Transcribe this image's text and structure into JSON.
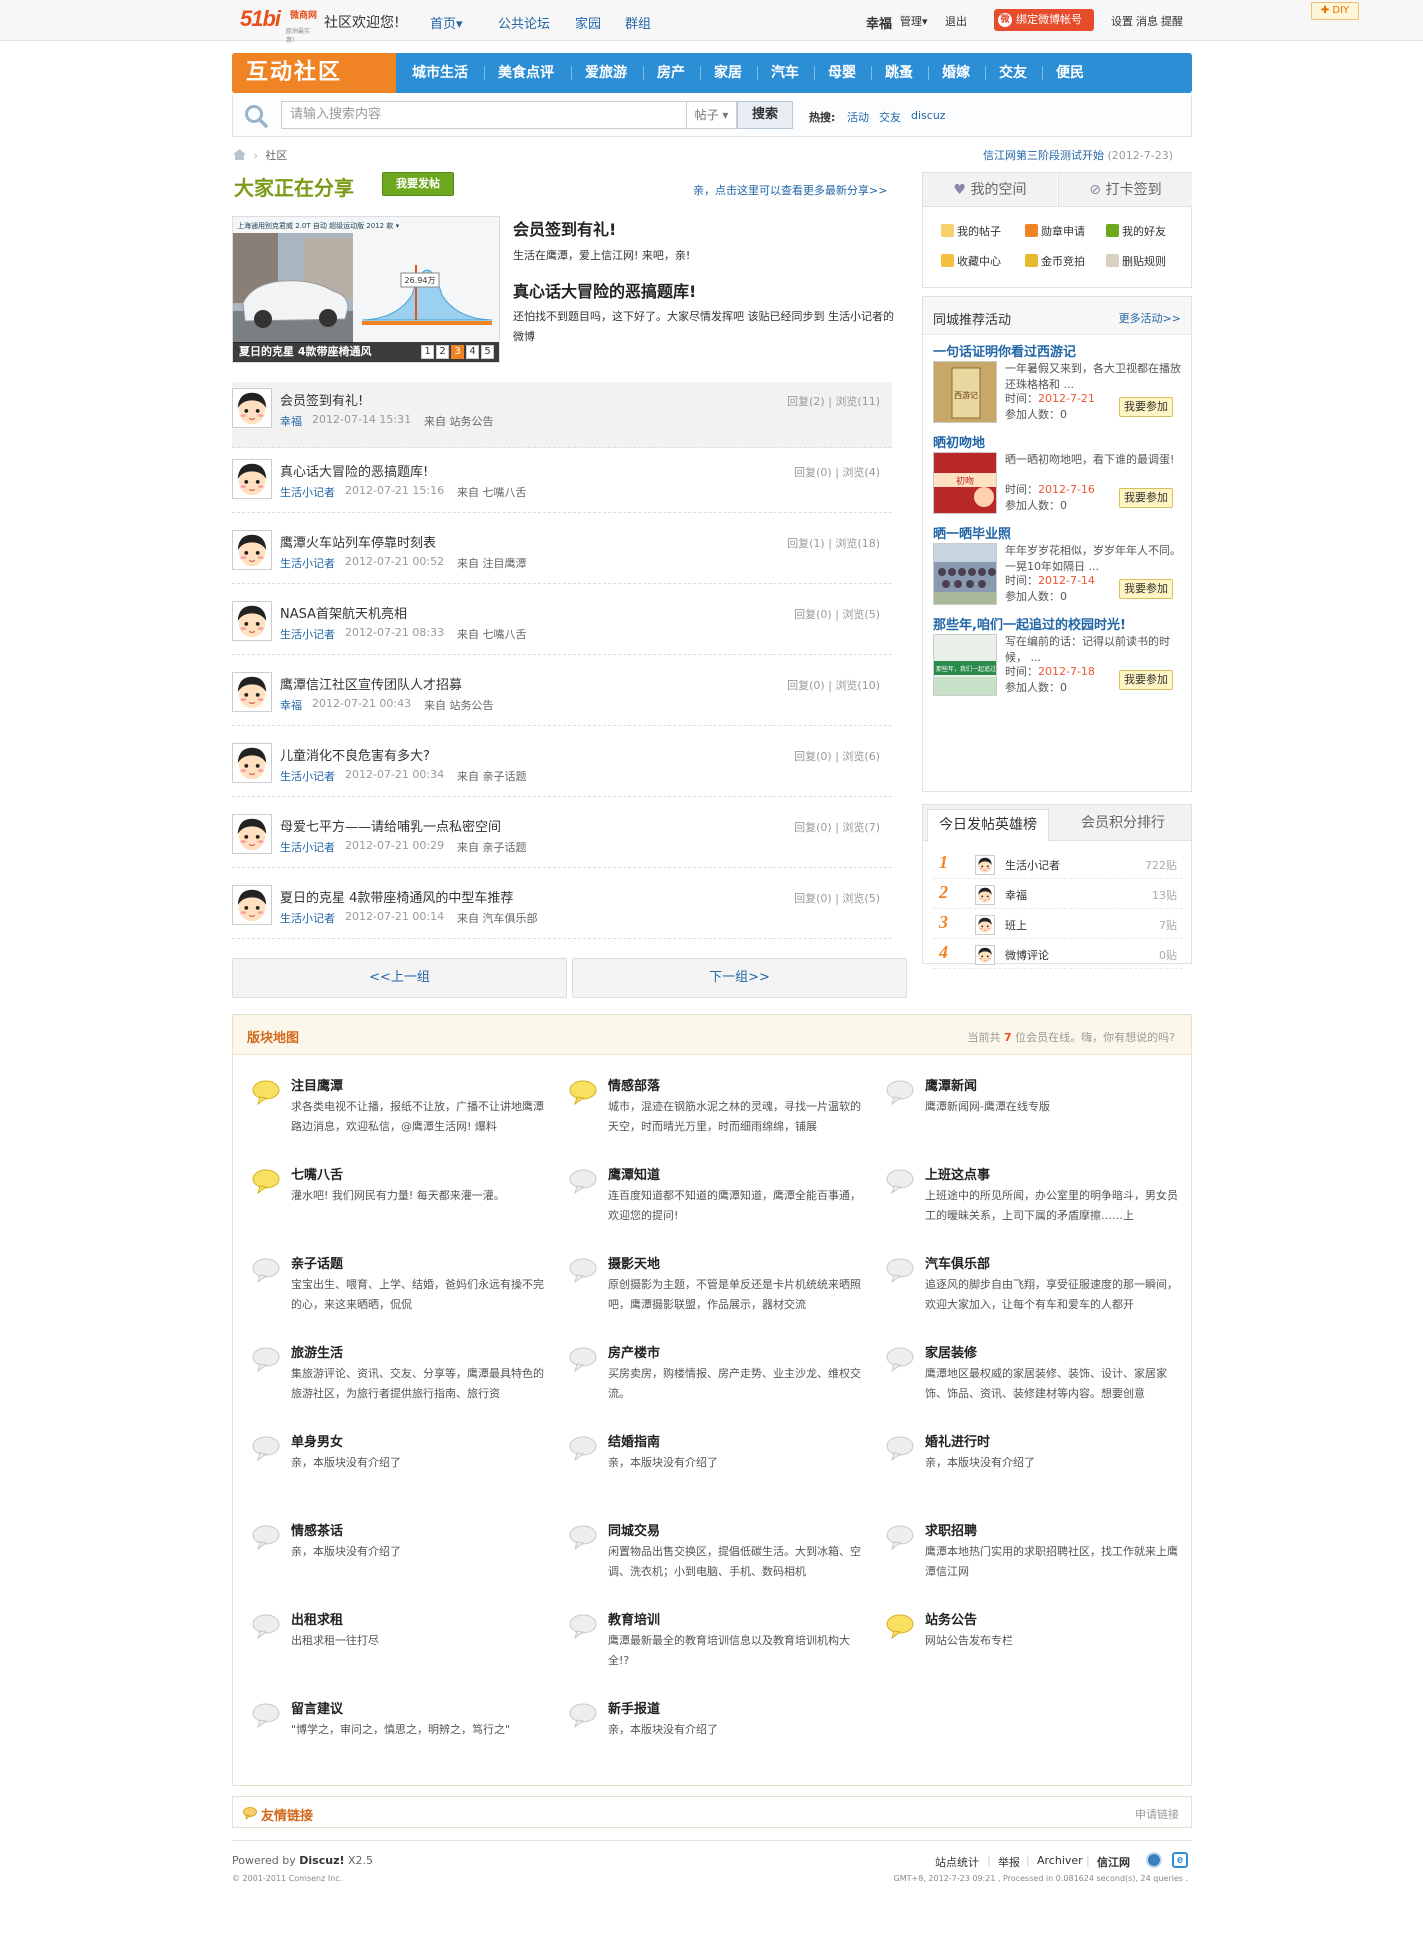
{
  "topbar": {
    "logo": {
      "main": "51bi",
      "sub": "微商网",
      "tagline": "欧洲最实惠!"
    },
    "welcome": "社区欢迎您!",
    "nav": [
      "首页▾",
      "公共论坛",
      "家园",
      "群组"
    ],
    "user": "幸福",
    "manage": "管理▾",
    "logout": "退出",
    "bind_weibo": "绑定微博帐号",
    "right_links": [
      "设置",
      "消息",
      "提醒"
    ],
    "diy": "DIY"
  },
  "nav": {
    "title": "互动社区",
    "items": [
      "城市生活",
      "美食点评",
      "爱旅游",
      "房产",
      "家居",
      "汽车",
      "母婴",
      "跳蚤",
      "婚嫁",
      "交友",
      "便民"
    ]
  },
  "search": {
    "placeholder": "请输入搜索内容",
    "type": "帖子 ▾",
    "button": "搜索",
    "hot_label": "热搜:",
    "hot": [
      "活动",
      "交友",
      "discuz"
    ]
  },
  "breadcrumb": {
    "home_icon": "home-icon",
    "current": "社区"
  },
  "notice": {
    "text": "信江网第三阶段测试开始",
    "date": "(2012-7-23)"
  },
  "share": {
    "title": "大家正在分享",
    "post_button": "我要发帖",
    "more": "亲，点击这里可以查看更多最新分享>>"
  },
  "slide": {
    "caption": "夏日的克星 4款带座椅通风",
    "pages": [
      "1",
      "2",
      "3",
      "4",
      "5"
    ],
    "active_page": 3,
    "header_text": "上海通用别克君威  2.0T 自动 超级运动版 2012 款 ▾",
    "price": "26.94万"
  },
  "headlines": [
    {
      "title": "会员签到有礼!",
      "desc": "生活在鹰潭，爱上信江网!  来吧，亲!"
    },
    {
      "title": "真心话大冒险的恶搞题库!",
      "desc": "还怕找不到题目吗，这下好了。大家尽情发挥吧 该贴已经同步到 生活小记者的微博"
    }
  ],
  "posts": [
    {
      "title": "会员签到有礼!",
      "user": "幸福",
      "date": "2012-07-14 15:31",
      "from": "来自 站务公告",
      "stats": "回复(2) | 浏览(11)"
    },
    {
      "title": "真心话大冒险的恶搞题库!",
      "user": "生活小记者",
      "date": "2012-07-21 15:16",
      "from": "来自 七嘴八舌",
      "stats": "回复(0) | 浏览(4)"
    },
    {
      "title": "鹰潭火车站列车停靠时刻表",
      "user": "生活小记者",
      "date": "2012-07-21 00:52",
      "from": "来自 注目鹰潭",
      "stats": "回复(1) | 浏览(18)"
    },
    {
      "title": "NASA首架航天机亮相",
      "user": "生活小记者",
      "date": "2012-07-21 08:33",
      "from": "来自 七嘴八舌",
      "stats": "回复(0) | 浏览(5)"
    },
    {
      "title": "鹰潭信江社区宣传团队人才招募",
      "user": "幸福",
      "date": "2012-07-21 00:43",
      "from": "来自 站务公告",
      "stats": "回复(0) | 浏览(10)"
    },
    {
      "title": "儿童消化不良危害有多大?",
      "user": "生活小记者",
      "date": "2012-07-21 00:34",
      "from": "来自 亲子话题",
      "stats": "回复(0) | 浏览(6)"
    },
    {
      "title": "母爱七平方——请给哺乳一点私密空间",
      "user": "生活小记者",
      "date": "2012-07-21 00:29",
      "from": "来自 亲子话题",
      "stats": "回复(0) | 浏览(7)"
    },
    {
      "title": "夏日的克星 4款带座椅通风的中型车推荐",
      "user": "生活小记者",
      "date": "2012-07-21 00:14",
      "from": "来自 汽车俱乐部",
      "stats": "回复(0) | 浏览(5)"
    }
  ],
  "pager": {
    "prev": "<<上一组",
    "next": "下一组>>"
  },
  "space": {
    "tabs": [
      "我的空间",
      "打卡签到"
    ],
    "links": [
      "我的帖子",
      "勋章申请",
      "我的好友",
      "收藏中心",
      "金币竞拍",
      "删贴规则"
    ]
  },
  "activities": {
    "title": "同城推荐活动",
    "more": "更多活动>>",
    "join": "我要参加",
    "items": [
      {
        "title": "一句话证明你看过西游记",
        "desc": "一年暑假又来到，各大卫视都在播放还珠格格和 ...",
        "time_label": "时间：",
        "time": "2012-7-21",
        "count": "参加人数：0",
        "img_text": "西游记"
      },
      {
        "title": "晒初吻地",
        "desc": "晒一晒初吻地吧，看下谁的最调蛋!",
        "time_label": "时间：",
        "time": "2012-7-16",
        "count": "参加人数：0",
        "img_text": "初吻"
      },
      {
        "title": "晒一晒毕业照",
        "desc": "年年岁岁花相似，岁岁年年人不同。一晃10年如隔日 ...",
        "time_label": "时间：",
        "time": "2012-7-14",
        "count": "参加人数：0",
        "img_text": ""
      },
      {
        "title": "那些年,咱们一起追过的校园时光!",
        "desc": "写在编前的话：记得以前读书的时候，  ...",
        "time_label": "时间：",
        "time": "2012-7-18",
        "count": "参加人数：0",
        "img_text": "那些年，我们一起追过"
      }
    ]
  },
  "ranking": {
    "tabs": [
      "今日发帖英雄榜",
      "会员积分排行"
    ],
    "rows": [
      {
        "rank": "1",
        "name": "生活小记者",
        "count": "722贴"
      },
      {
        "rank": "2",
        "name": "幸福",
        "count": "13贴"
      },
      {
        "rank": "3",
        "name": "班上",
        "count": "7贴"
      },
      {
        "rank": "4",
        "name": "微博评论",
        "count": "0贴"
      }
    ]
  },
  "forum_map": {
    "title": "版块地图",
    "online_pre": "当前共",
    "online_count": "7",
    "online_post": "位会员在线。嗨，你有想说的吗?",
    "boards": [
      {
        "name": "注目鹰潭",
        "desc": "求各类电视不让播，报纸不让放，广播不让讲地鹰潭路边消息，欢迎私信，@鹰潭生活网! 爆料",
        "active": true
      },
      {
        "name": "情感部落",
        "desc": "城市，混迹在钢筋水泥之林的灵魂，寻找一片温软的天空，时而晴光万里，时而细雨绵绵，铺展",
        "active": true
      },
      {
        "name": "鹰潭新闻",
        "desc": "鹰潭新闻网-鹰潭在线专版",
        "active": false
      },
      {
        "name": "七嘴八舌",
        "desc": "灌水吧! 我们网民有力量! 每天都来灌一灌。",
        "active": true
      },
      {
        "name": "鹰潭知道",
        "desc": "连百度知道都不知道的鹰潭知道，鹰潭全能百事通，欢迎您的提问!",
        "active": false
      },
      {
        "name": "上班这点事",
        "desc": "上班途中的所见所闻，办公室里的明争暗斗，男女员工的暧昧关系，上司下属的矛盾摩擦……上",
        "active": false
      },
      {
        "name": "亲子话题",
        "desc": "宝宝出生、喂育、上学、结婚，爸妈们永远有操不完的心，来这来晒晒，侃侃",
        "active": false
      },
      {
        "name": "摄影天地",
        "desc": "原创摄影为主题，不管是单反还是卡片机统统来晒照吧，鹰潭摄影联盟，作品展示，器材交流",
        "active": false
      },
      {
        "name": "汽车俱乐部",
        "desc": "追逐风的脚步自由飞翔，享受征服速度的那一瞬间，欢迎大家加入，让每个有车和爱车的人都开",
        "active": false
      },
      {
        "name": "旅游生活",
        "desc": "集旅游评论、资讯、交友、分享等，鹰潭最具特色的旅游社区，为旅行者提供旅行指南、旅行资",
        "active": false
      },
      {
        "name": "房产楼市",
        "desc": "买房卖房，购楼情报、房产走势、业主沙龙、维权交流。",
        "active": false
      },
      {
        "name": "家居装修",
        "desc": "鹰潭地区最权威的家居装修、装饰、设计、家居家饰、饰品、资讯、装修建材等内容。想要创意",
        "active": false
      },
      {
        "name": "单身男女",
        "desc": "亲，本版块没有介绍了",
        "active": false
      },
      {
        "name": "结婚指南",
        "desc": "亲，本版块没有介绍了",
        "active": false
      },
      {
        "name": "婚礼进行时",
        "desc": "亲，本版块没有介绍了",
        "active": false
      },
      {
        "name": "情感茶话",
        "desc": "亲，本版块没有介绍了",
        "active": false
      },
      {
        "name": "同城交易",
        "desc": "闲置物品出售交换区，提倡低碳生活。大到冰箱、空调、洗衣机；小到电脑、手机、数码相机",
        "active": false
      },
      {
        "name": "求职招聘",
        "desc": "鹰潭本地热门实用的求职招聘社区，找工作就来上鹰潭信江网",
        "active": false
      },
      {
        "name": "出租求租",
        "desc": "出租求租一往打尽",
        "active": false
      },
      {
        "name": "教育培训",
        "desc": "鹰潭最新最全的教育培训信息以及教育培训机构大全!?",
        "active": false
      },
      {
        "name": "站务公告",
        "desc": "网站公告发布专栏",
        "active": true
      },
      {
        "name": "留言建议",
        "desc": "\"博学之，审问之，慎思之，明辨之，笃行之\"",
        "active": false
      },
      {
        "name": "新手报道",
        "desc": "亲，本版块没有介绍了",
        "active": false
      }
    ]
  },
  "friend_links": {
    "title": "友情链接",
    "apply": "申请链接"
  },
  "footer": {
    "powered_pre": "Powered by",
    "powered_brand": "Discuz!",
    "powered_ver": "X2.5",
    "copyright": "© 2001-2011 Comsenz Inc.",
    "links": [
      "站点统计",
      "举报",
      "Archiver",
      "信江网"
    ],
    "gmt": "GMT+8, 2012-7-23 09:21 , Processed in 0.081624 second(s), 24 queries ."
  },
  "colors": {
    "nav_blue": "#2c8fd6",
    "brand_orange": "#f08324",
    "link_blue": "#2366a8",
    "green": "#6ea81f"
  }
}
